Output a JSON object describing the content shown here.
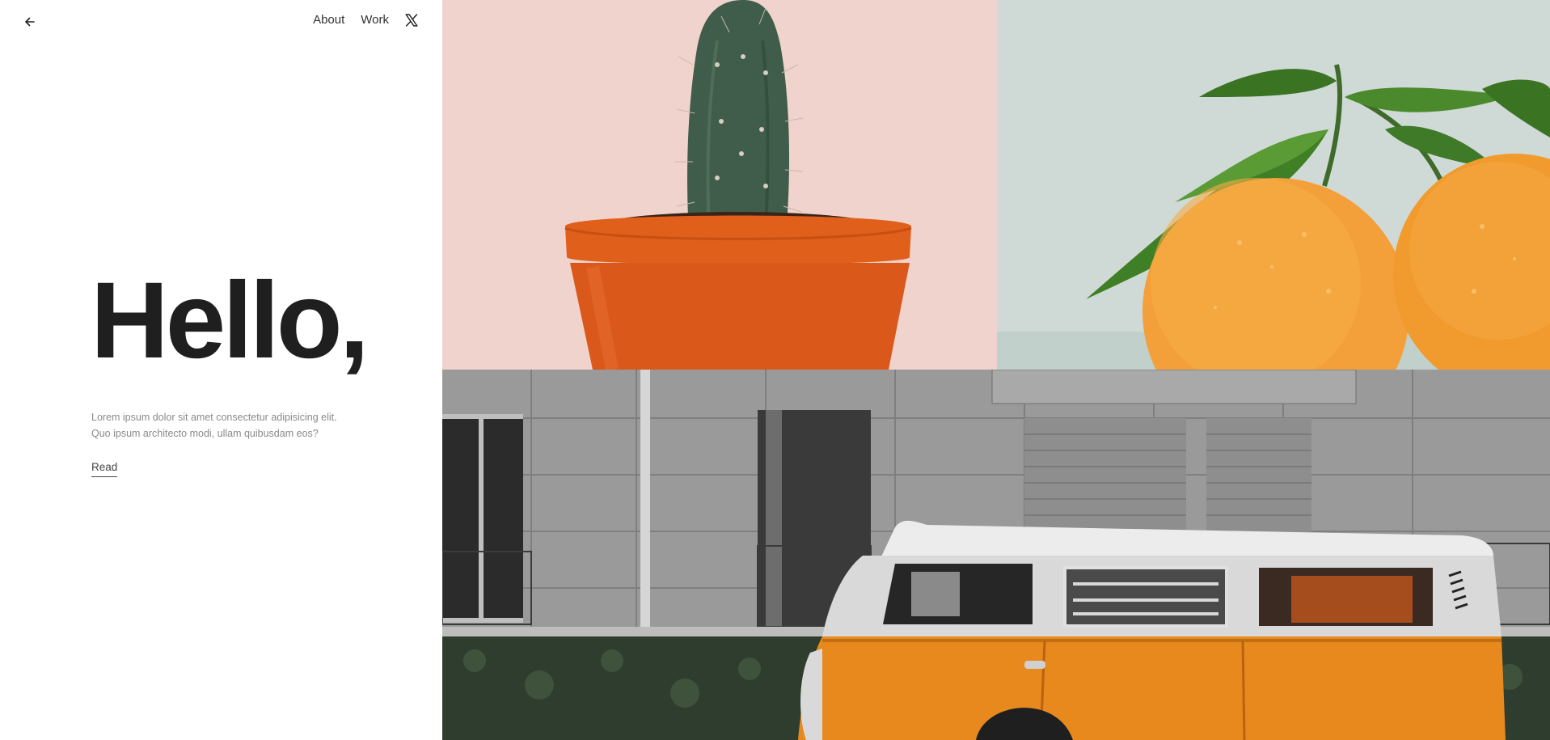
{
  "nav": {
    "back_icon": "arrow-left-icon",
    "links": [
      "About",
      "Work"
    ],
    "social_icon": "x-twitter-icon"
  },
  "hero": {
    "title": "Hello,",
    "description": "Lorem ipsum dolor sit amet consectetur adipisicing elit. Quo ipsum architecto modi, ullam quibusdam eos?",
    "read_label": "Read"
  },
  "colors": {
    "text": "#1f1f1f",
    "muted": "#8a8a8a",
    "cactus_bg": "#f1d3cd",
    "orange_bg": "#cfdad6",
    "van_orange": "#e8891e"
  }
}
